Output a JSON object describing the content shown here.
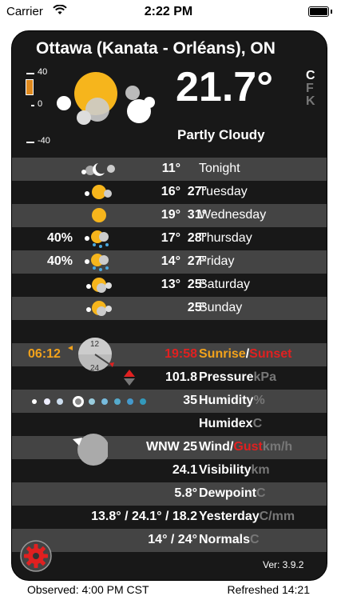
{
  "status": {
    "carrier": "Carrier",
    "time": "2:22 PM"
  },
  "location": "Ottawa (Kanata - Orléans), ON",
  "current": {
    "temp": "21.7°",
    "condition": "Partly Cloudy",
    "units": [
      "C",
      "F",
      "K"
    ],
    "scale": {
      "top": "40",
      "mid": "0",
      "bottom": "-40"
    }
  },
  "forecast": [
    {
      "pct": "",
      "lo": "11°",
      "hi": "",
      "day": "Tonight",
      "icon": "night-partly-cloudy-icon"
    },
    {
      "pct": "",
      "lo": "16°",
      "hi": "27°",
      "day": "Tuesday",
      "icon": "partly-cloudy-icon"
    },
    {
      "pct": "",
      "lo": "19°",
      "hi": "31°",
      "day": "Wednesday",
      "icon": "sunny-icon"
    },
    {
      "pct": "40%",
      "lo": "17°",
      "hi": "28°",
      "day": "Thursday",
      "icon": "thunderstorm-icon"
    },
    {
      "pct": "40%",
      "lo": "14°",
      "hi": "27°",
      "day": "Friday",
      "icon": "showers-icon"
    },
    {
      "pct": "",
      "lo": "13°",
      "hi": "25°",
      "day": "Saturday",
      "icon": "partly-cloudy-icon"
    },
    {
      "pct": "",
      "lo": "",
      "hi": "25°",
      "day": "Sunday",
      "icon": "partly-cloudy-icon"
    }
  ],
  "sun": {
    "rise": "06:12",
    "set": "19:58",
    "label_rise": "Sunrise",
    "label_sep": "/",
    "label_set": "Sunset",
    "dial_top": "12",
    "dial_bottom": "24"
  },
  "pressure": {
    "value": "101.8",
    "label": "Pressure",
    "unit": "kPa"
  },
  "humidity": {
    "value": "35",
    "label": "Humidity",
    "unit": "%"
  },
  "humidex": {
    "label": "Humidex",
    "unit": "C"
  },
  "wind": {
    "value": "WNW 25",
    "label": "Wind",
    "sep": "/",
    "gust": "Gust",
    "unit": "km/h"
  },
  "visibility": {
    "value": "24.1",
    "label": "Visibility",
    "unit": "km"
  },
  "dewpoint": {
    "value": "5.8°",
    "label": "Dewpoint",
    "unit": "C"
  },
  "yesterday": {
    "value": "13.8° / 24.1° / 18.2",
    "label": "Yesterday",
    "unit": "C/mm"
  },
  "normals": {
    "value": "14° / 24°",
    "label": "Normals",
    "unit": "C"
  },
  "version": "Ver: 3.9.2",
  "footer": {
    "observed": "Observed: 4:00 PM CST",
    "refreshed": "Refreshed 14:21"
  }
}
